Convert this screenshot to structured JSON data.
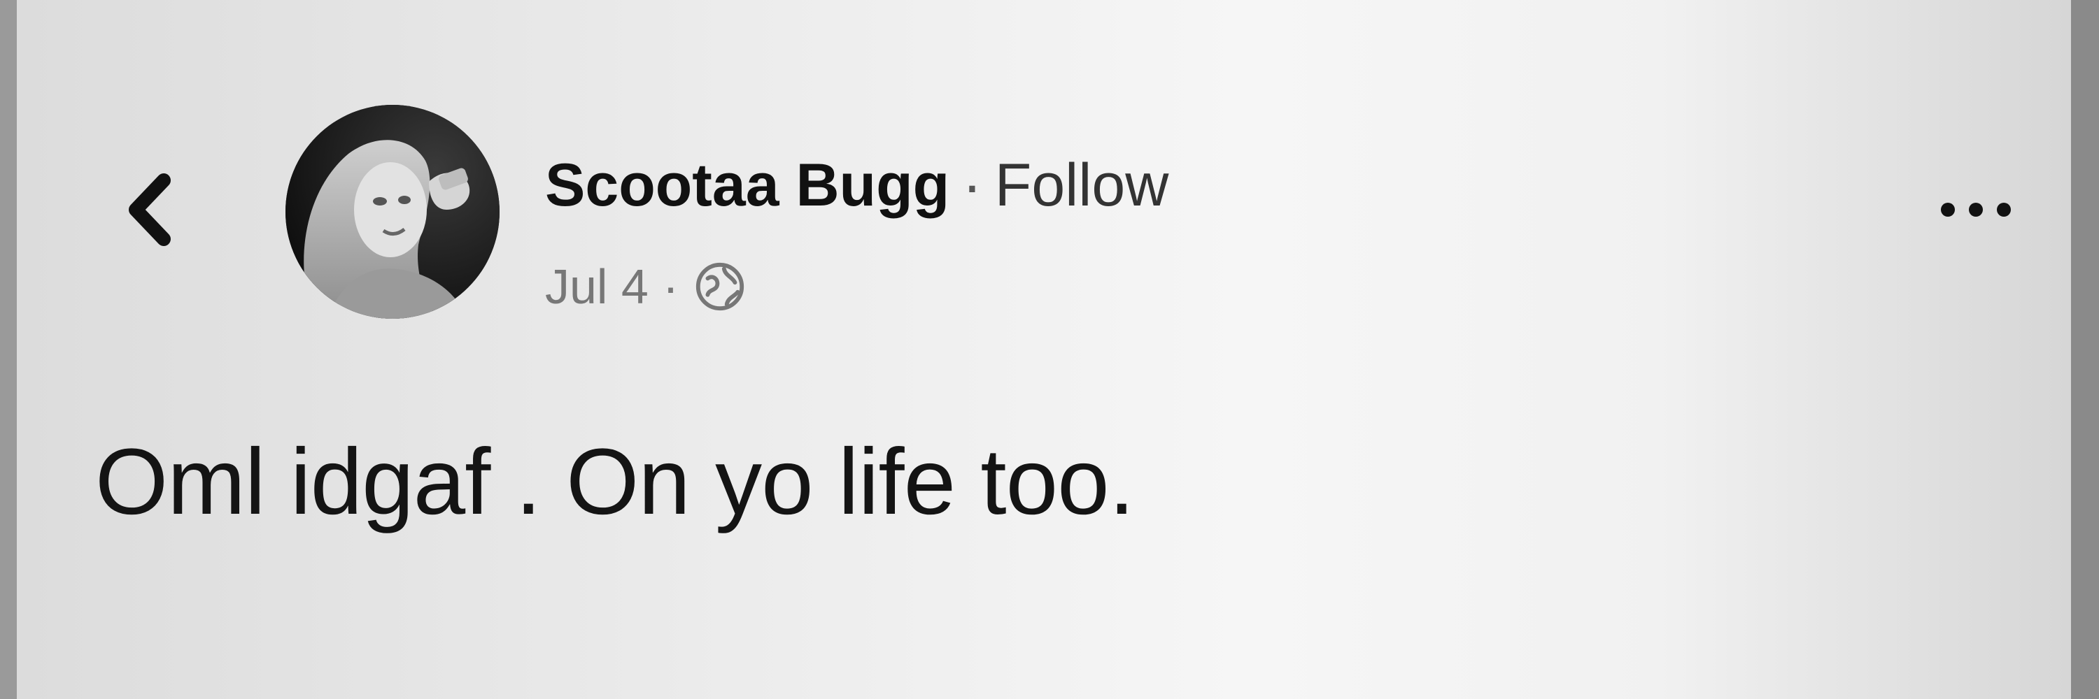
{
  "post": {
    "author_name": "Scootaa Bugg",
    "separator": "·",
    "follow_label": "Follow",
    "date": "Jul 4",
    "meta_separator": "·",
    "privacy_icon": "globe-icon",
    "text": "Oml idgaf . On yo life too."
  },
  "nav": {
    "back_icon": "chevron-left-icon",
    "more_icon": "more-horizontal-icon"
  },
  "colors": {
    "background": "#f1f1f1",
    "text": "#111111",
    "muted": "#777777"
  }
}
